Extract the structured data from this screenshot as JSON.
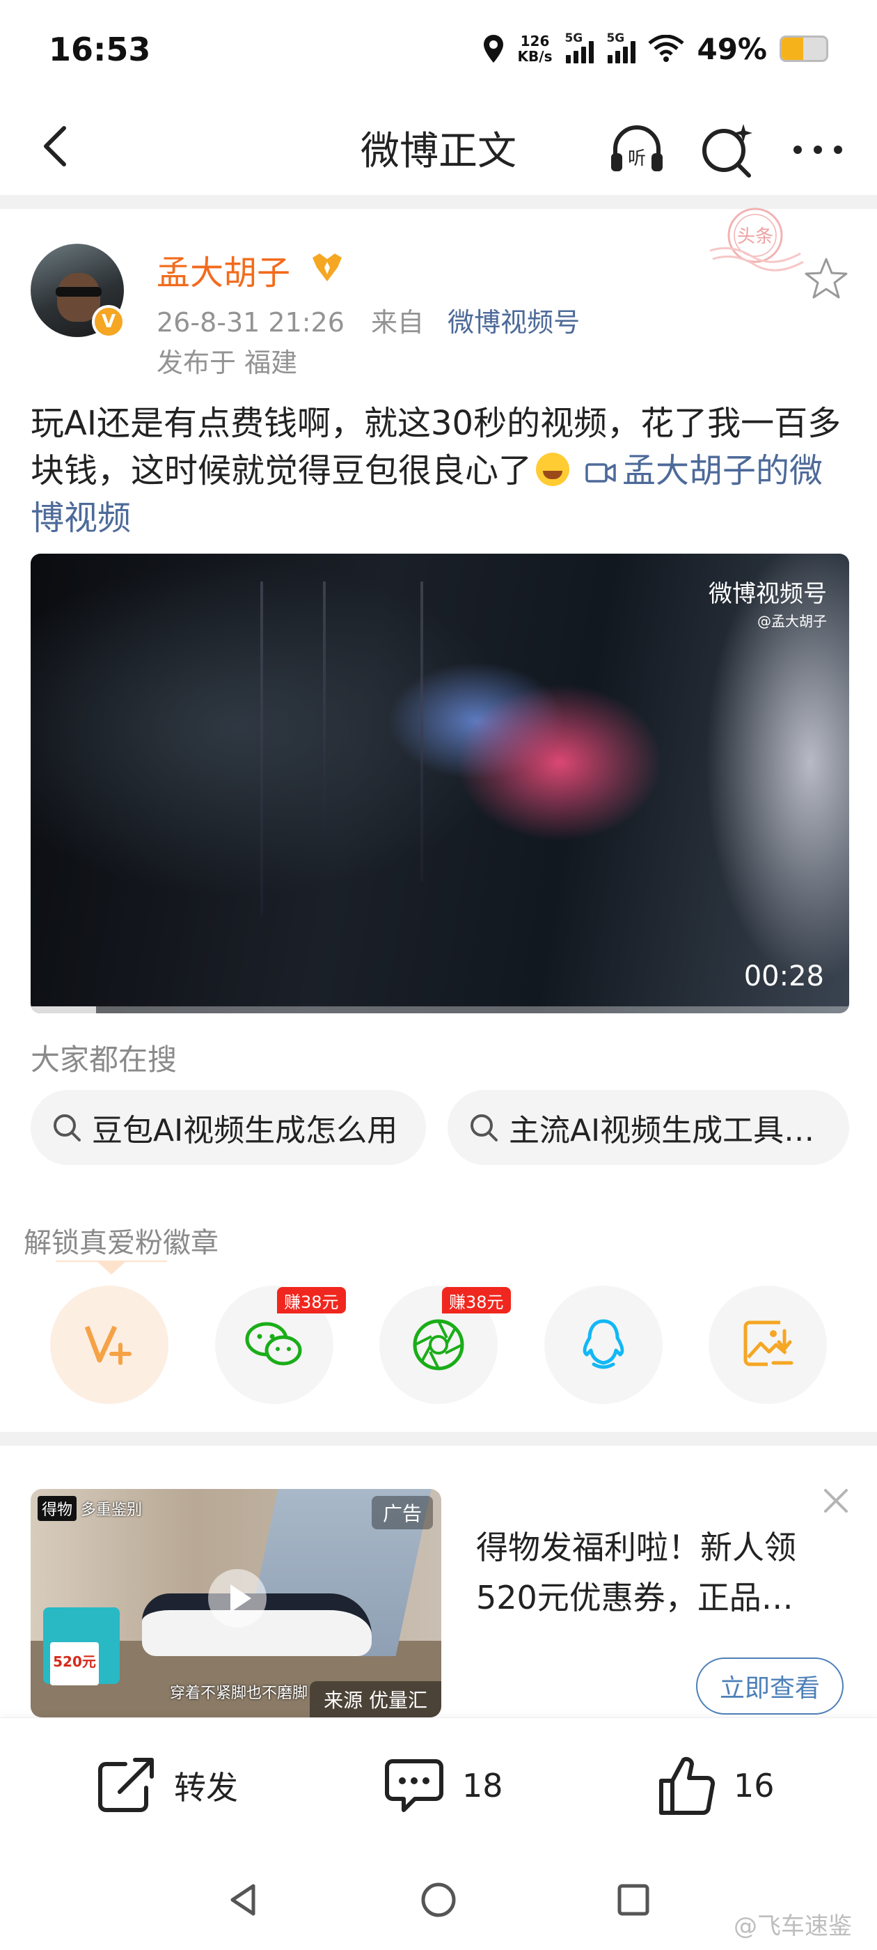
{
  "status_bar": {
    "time": "16:53",
    "speed_value": "126",
    "speed_unit": "KB/s",
    "signal1_label": "5G",
    "signal2_label": "5G",
    "battery_text": "49%",
    "battery_level": 0.49
  },
  "nav": {
    "title": "微博正文",
    "listen_label": "听"
  },
  "post": {
    "username": "孟大胡子",
    "verified_glyph": "V",
    "datetime": "26-8-31 21:26",
    "source_prefix": "来自",
    "source": "微博视频号",
    "location": "发布于 福建",
    "stamp_text": "头条",
    "text": "玩AI还是有点费钱啊，就这30秒的视频，花了我一百多块钱，这时候就觉得豆包很良心了",
    "video_link_text": "孟大胡子的微博视频",
    "video": {
      "watermark": "微博视频号",
      "watermark_sub": "@孟大胡子",
      "duration": "00:28",
      "progress": 0.08
    }
  },
  "search": {
    "heading": "大家都在搜",
    "chips": [
      "豆包AI视频生成怎么用",
      "主流AI视频生成工具…"
    ]
  },
  "unlock": {
    "heading": "解锁真爱粉徽章",
    "tags": [
      "赚38元",
      "赚38元"
    ]
  },
  "ad": {
    "tag": "广告",
    "brand1": "得物",
    "brand2": "多重鉴别",
    "box_price": "520元",
    "caption": "穿着不紧脚也不磨脚",
    "source_label": "来源 优量汇",
    "text": "得物发福利啦！新人领520元优惠券，正品…",
    "button": "立即查看"
  },
  "actions": {
    "repost": "转发",
    "comments": "18",
    "likes": "16"
  },
  "watermark": "@飞车速鉴",
  "colors": {
    "username": "#f26b1d",
    "link": "#4d6a99",
    "earn_tag": "#f0271e",
    "ad_button": "#4d80b8"
  }
}
